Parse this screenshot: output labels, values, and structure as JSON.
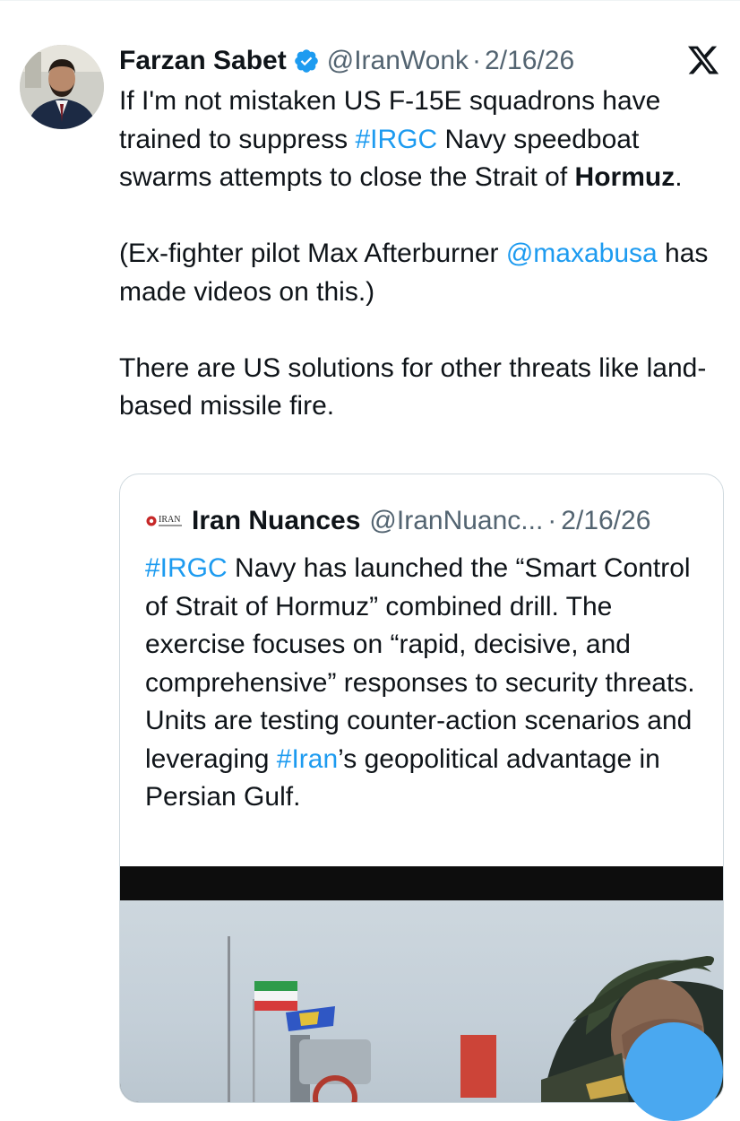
{
  "tweet": {
    "author_name": "Farzan Sabet",
    "handle": "@IranWonk",
    "separator": "·",
    "date": "2/16/26",
    "paragraphs": [
      [
        {
          "text": "If I'm not mistaken US F-15E squadrons have trained to suppress ",
          "style": "plain"
        },
        {
          "text": "#IRGC",
          "style": "link"
        },
        {
          "text": " Navy speedboat swarms attempts to close the Strait of ",
          "style": "plain"
        },
        {
          "text": "Hormuz",
          "style": "bold"
        },
        {
          "text": ".",
          "style": "plain"
        }
      ],
      [
        {
          "text": "(Ex-fighter pilot Max Afterburner ",
          "style": "plain"
        },
        {
          "text": "@maxabusa",
          "style": "link"
        },
        {
          "text": " has made videos on this.)",
          "style": "plain"
        }
      ],
      [
        {
          "text": "There are US solutions for other threats like land-based missile fire.",
          "style": "plain"
        }
      ]
    ]
  },
  "quoted_tweet": {
    "author_name": "Iran Nuances",
    "handle": "@IranNuanc...",
    "separator": "·",
    "date": "2/16/26",
    "logo_text": "IRAN",
    "segments": [
      {
        "text": "#IRGC",
        "style": "link"
      },
      {
        "text": " Navy has launched the “Smart Control of Strait of Hormuz” combined drill. The exercise focuses on “rapid, decisive, and comprehensive” responses to security threats. Units are testing counter-action scenarios and leveraging ",
        "style": "plain"
      },
      {
        "text": "#Iran",
        "style": "link"
      },
      {
        "text": "’s geopolitical advantage in Persian Gulf.",
        "style": "plain"
      }
    ]
  },
  "colors": {
    "link": "#1d9bf0",
    "secondary_text": "#536471",
    "verified_badge": "#1d9bf0",
    "floating_button": "#4aa8f0"
  },
  "icons": [
    "verified-badge-icon",
    "x-logo-icon",
    "iran-nuances-logo-icon"
  ]
}
